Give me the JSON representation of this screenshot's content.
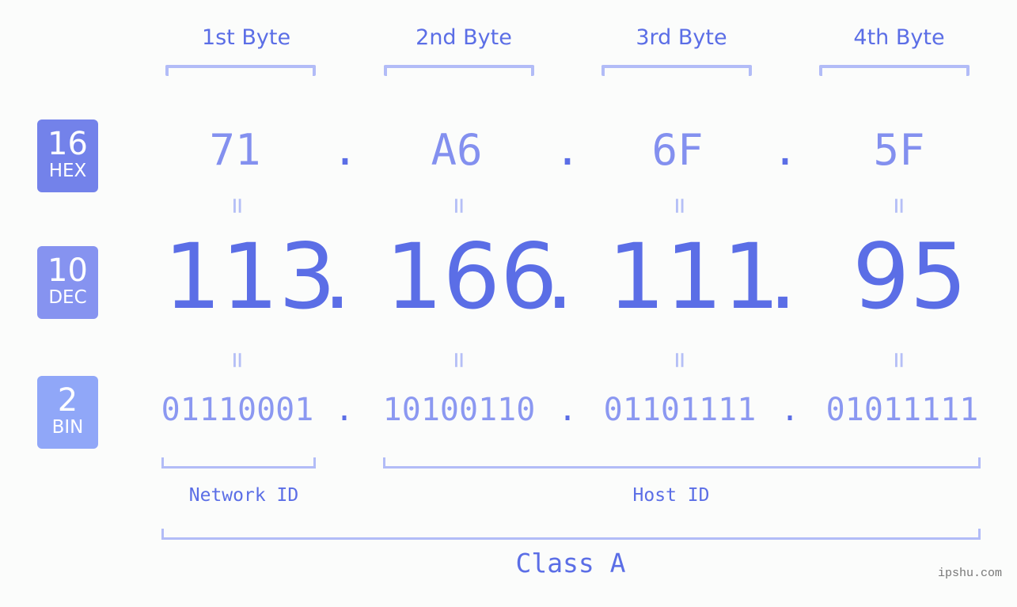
{
  "byte_headers": [
    "1st Byte",
    "2nd Byte",
    "3rd Byte",
    "4th Byte"
  ],
  "badges": [
    {
      "number": "16",
      "label": "HEX",
      "color": "#7382ea"
    },
    {
      "number": "10",
      "label": "DEC",
      "color": "#8693f0"
    },
    {
      "number": "2",
      "label": "BIN",
      "color": "#90a7f8"
    }
  ],
  "hex": [
    "71",
    "A6",
    "6F",
    "5F"
  ],
  "dec": [
    "113",
    "166",
    "111",
    "95"
  ],
  "bin": [
    "01110001",
    "10100110",
    "01101111",
    "01011111"
  ],
  "separator": ".",
  "equals": "=",
  "network_id_label": "Network ID",
  "host_id_label": "Host ID",
  "class_label": "Class A",
  "watermark": "ipshu.com",
  "colors": {
    "primary": "#5b6ee6",
    "hex_text": "#8390ef",
    "bin_text": "#8b98f1",
    "bracket": "#b2bcf7",
    "background": "#fbfcfb"
  }
}
